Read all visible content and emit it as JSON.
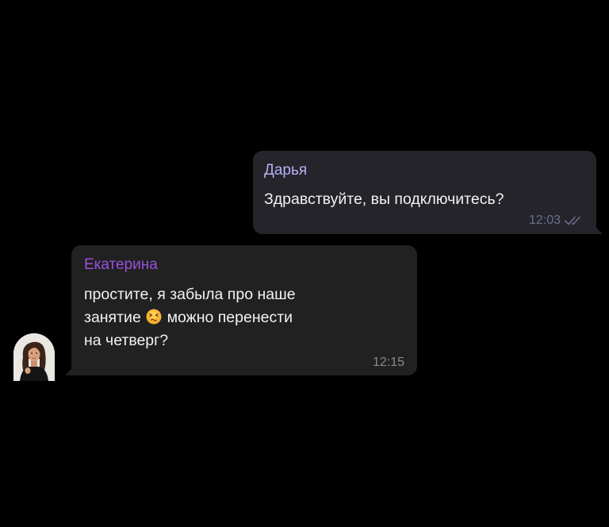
{
  "theme": {
    "sender_out_color": "#b6b0f5",
    "sender_in_color": "#9a4fe0"
  },
  "messages": [
    {
      "direction": "outgoing",
      "sender": "Дарья",
      "text": "Здравствуйте, вы подключитесь?",
      "time": "12:03",
      "status_icon": "double-check-icon"
    },
    {
      "direction": "incoming",
      "sender": "Екатерина",
      "lines": {
        "line1": "простите, я забыла про наше",
        "line2_before": "занятие",
        "line2_emoji": "persevering-face-emoji",
        "line2_after": "можно перенести",
        "line3": "на четверг?"
      },
      "time": "12:15",
      "avatar_icon": "contact-avatar"
    }
  ]
}
